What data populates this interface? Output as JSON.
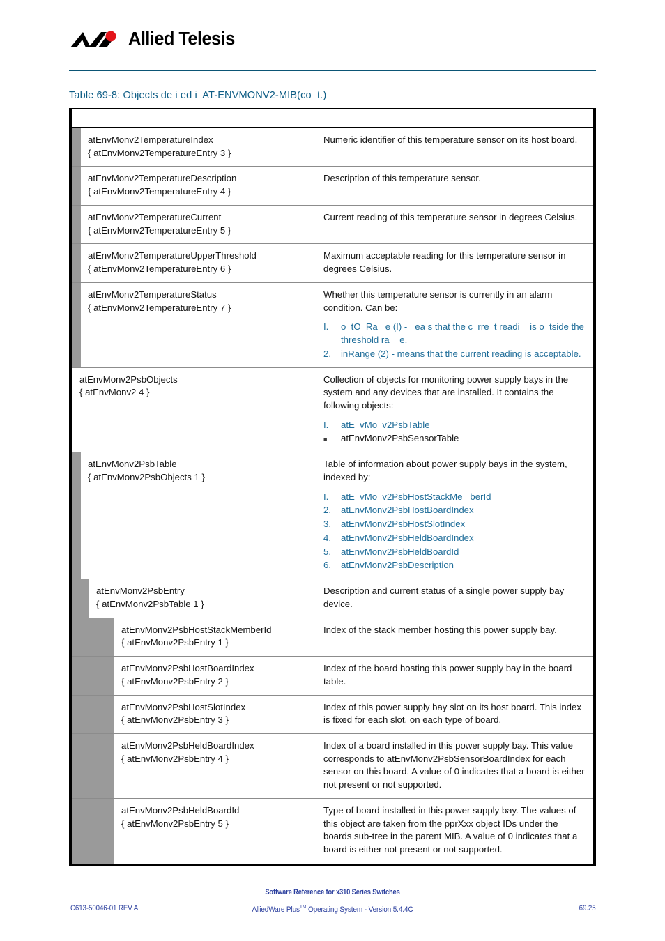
{
  "header": {
    "brand_name": "Allied Telesis",
    "logo_icon": "allied-telesis-logo-icon",
    "logo_red_color": "#e3141a",
    "rule_color": "#0b5575"
  },
  "caption": {
    "text": "Table 69-8: Objects de i ed i  AT-ENVMONV2-MIB(co  t.)",
    "color": "#0e5d85"
  },
  "table": {
    "header": {
      "col_object": "",
      "col_description": ""
    },
    "rows": [
      {
        "indent": 1,
        "name": "atEnvMonv2TemperatureIndex\n{ atEnvMonv2TemperatureEntry 3 }",
        "description": "Numeric identifier of this temperature sensor on its host board."
      },
      {
        "indent": 1,
        "name": "atEnvMonv2TemperatureDescription\n{ atEnvMonv2TemperatureEntry 4 }",
        "description": "Description of this temperature sensor."
      },
      {
        "indent": 1,
        "name": "atEnvMonv2TemperatureCurrent\n{ atEnvMonv2TemperatureEntry 5 }",
        "description": "Current reading of this temperature sensor in degrees Celsius."
      },
      {
        "indent": 1,
        "name": "atEnvMonv2TemperatureUpperThreshold\n{ atEnvMonv2TemperatureEntry 6 }",
        "description": "Maximum acceptable reading for this temperature sensor in degrees Celsius."
      },
      {
        "indent": 1,
        "name": "atEnvMonv2TemperatureStatus\n{ atEnvMonv2TemperatureEntry 7 }",
        "description": "Whether this temperature sensor is currently in an alarm condition. Can be:",
        "list": [
          {
            "marker": "I.",
            "text": "o  tO  Ra   e (I) -   ea s that the c  rre  t readi    is o  tside the threshold ra    e.",
            "style": "blue"
          },
          {
            "marker": "2.",
            "text": "inRange (2) - means that the current reading is acceptable.",
            "style": "blue"
          }
        ]
      },
      {
        "indent": 0,
        "name": "atEnvMonv2PsbObjects\n{ atEnvMonv2 4 }",
        "description": "Collection of objects for monitoring power supply bays in the system and any devices that are installed. It contains the following objects:",
        "list": [
          {
            "marker": "I.",
            "text": "atE  vMo  v2PsbTable",
            "style": "blue"
          },
          {
            "marker": "square",
            "text": "atEnvMonv2PsbSensorTable",
            "style": "dark"
          }
        ]
      },
      {
        "indent": 1,
        "name": "atEnvMonv2PsbTable\n{ atEnvMonv2PsbObjects 1 }",
        "description": "Table of information about power supply bays in the system, indexed by:",
        "list": [
          {
            "marker": "I.",
            "text": "atE  vMo  v2PsbHostStackMe   berId",
            "style": "blue"
          },
          {
            "marker": "2.",
            "text": "atEnvMonv2PsbHostBoardIndex",
            "style": "blue"
          },
          {
            "marker": "3.",
            "text": "atEnvMonv2PsbHostSlotIndex",
            "style": "blue"
          },
          {
            "marker": "4.",
            "text": "atEnvMonv2PsbHeldBoardIndex",
            "style": "blue"
          },
          {
            "marker": "5.",
            "text": "atEnvMonv2PsbHeldBoardId",
            "style": "blue"
          },
          {
            "marker": "6.",
            "text": "atEnvMonv2PsbDescription",
            "style": "blue"
          }
        ]
      },
      {
        "indent": 2,
        "name": "atEnvMonv2PsbEntry\n{ atEnvMonv2PsbTable 1 }",
        "description": "Description and current status of a single power supply bay device."
      },
      {
        "indent": 3,
        "name": "atEnvMonv2PsbHostStackMemberId\n{ atEnvMonv2PsbEntry 1 }",
        "description": "Index of the stack member hosting this power supply bay."
      },
      {
        "indent": 3,
        "name": "atEnvMonv2PsbHostBoardIndex\n{ atEnvMonv2PsbEntry 2 }",
        "description": "Index of the board hosting this power supply bay in the board table."
      },
      {
        "indent": 3,
        "name": "atEnvMonv2PsbHostSlotIndex\n{ atEnvMonv2PsbEntry 3 }",
        "description": "Index of this power supply bay slot on its host board. This index is fixed for each slot, on each type of board."
      },
      {
        "indent": 3,
        "name": "atEnvMonv2PsbHeldBoardIndex\n{ atEnvMonv2PsbEntry 4 }",
        "description": "Index of a board installed in this power supply bay. This value corresponds to atEnvMonv2PsbSensorBoardIndex for each sensor on this board. A value of 0 indicates that a board is either not present or not supported."
      },
      {
        "indent": 3,
        "name": "atEnvMonv2PsbHeldBoardId\n{ atEnvMonv2PsbEntry 5 }",
        "description": "Type of board installed in this power supply bay. The values of this object are taken from the pprXxx object IDs under the boards sub-tree in the parent MIB. A value of 0 indicates that a board is either not present or not supported."
      }
    ]
  },
  "footer": {
    "title": "Software Reference for x310 Series Switches",
    "subtitle_before": "AlliedWare Plus",
    "subtitle_sup": "TM",
    "subtitle_after": " Operating System - Version 5.4.4C",
    "doc_id": "C613-50046-01 REV A",
    "page_number": "69.25",
    "color": "#2b3f9e"
  }
}
